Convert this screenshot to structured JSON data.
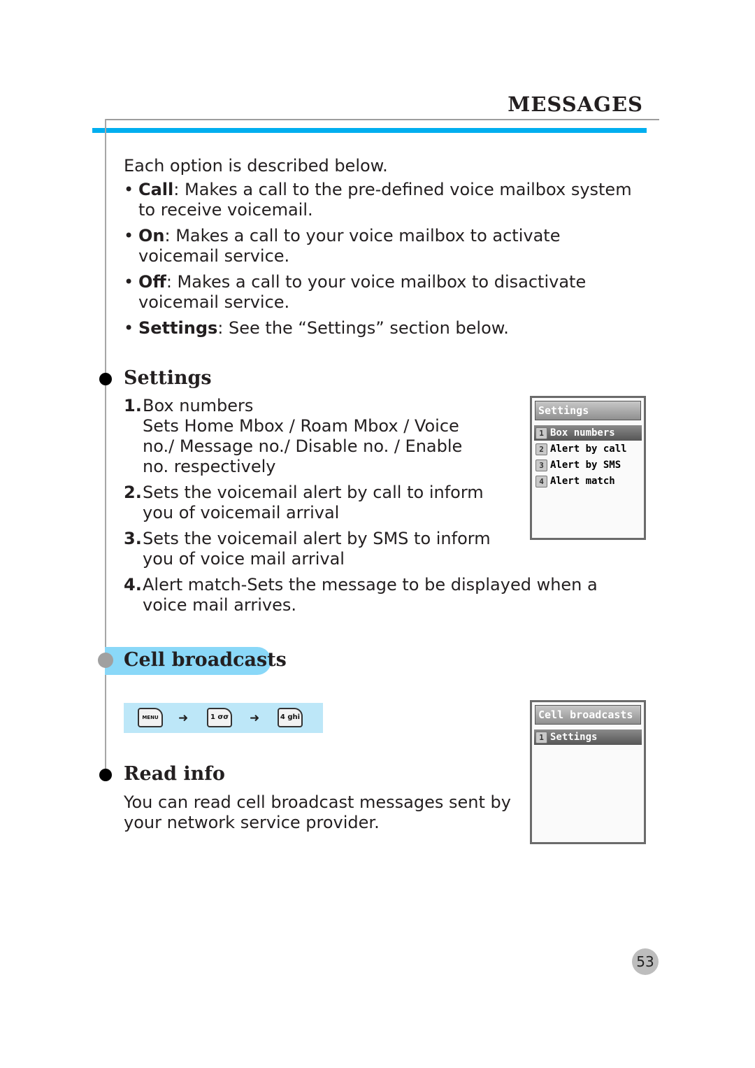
{
  "header": {
    "title": "MESSAGES"
  },
  "intro": "Each option is described below.",
  "options": [
    {
      "term": "Call",
      "desc": ": Makes a call to the pre-defined voice mailbox system to receive voicemail."
    },
    {
      "term": "On",
      "desc": ": Makes a call to your voice mailbox to activate voicemail service."
    },
    {
      "term": "Off",
      "desc": ": Makes a call to your voice mailbox to disactivate voicemail service."
    },
    {
      "term": "Settings",
      "desc": ": See the “Settings” section below."
    }
  ],
  "settings": {
    "heading": "Settings",
    "items": [
      {
        "num": "1.",
        "text": "Box numbers",
        "sub": "Sets Home Mbox / Roam Mbox / Voice no./ Message no./ Disable no. / Enable no. respectively"
      },
      {
        "num": "2.",
        "text": "Sets the voicemail alert by call to inform you of voicemail arrival"
      },
      {
        "num": "3.",
        "text": "Sets the voicemail alert by SMS to inform you of voice mail arrival"
      },
      {
        "num": "4.",
        "text": "Alert match-Sets the message to be displayed when a voice mail arrives."
      }
    ],
    "screen": {
      "title": "Settings",
      "items": [
        {
          "num": "1",
          "label": "Box numbers",
          "selected": true
        },
        {
          "num": "2",
          "label": "Alert by call",
          "selected": false
        },
        {
          "num": "3",
          "label": "Alert by SMS",
          "selected": false
        },
        {
          "num": "4",
          "label": "Alert match",
          "selected": false
        }
      ]
    }
  },
  "cell_broadcasts": {
    "heading": "Cell broadcasts",
    "keys": [
      {
        "label": "MENU",
        "icon": "menu-key-icon"
      },
      {
        "label": "1 σσ",
        "icon": "key-1-icon"
      },
      {
        "label": "4 ghi",
        "icon": "key-4-icon"
      }
    ],
    "arrow": "➜",
    "screen": {
      "title": "Cell broadcasts",
      "items": [
        {
          "num": "1",
          "label": "Settings",
          "selected": true
        }
      ]
    }
  },
  "read_info": {
    "heading": "Read info",
    "text": "You can read cell broadcast messages sent by your network service provider."
  },
  "page_number": "53"
}
